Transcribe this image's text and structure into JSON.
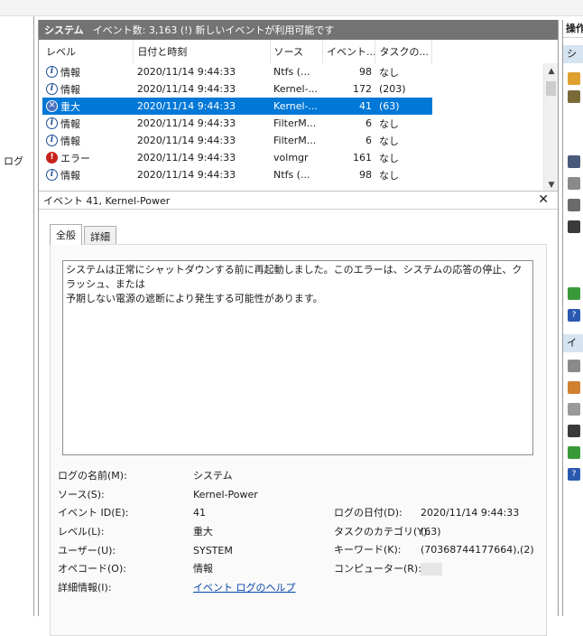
{
  "nav": {
    "log_label": "ログ"
  },
  "header": {
    "title": "システム",
    "info": "イベント数: 3,163 (!) 新しいイベントが利用可能です"
  },
  "grid": {
    "columns": [
      "レベル",
      "日付と時刻",
      "ソース",
      "イベント...",
      "タスクの..."
    ],
    "rows": [
      {
        "level": "情報",
        "icon": "information-icon",
        "datetime": "2020/11/14 9:44:33",
        "source": "Ntfs (...",
        "event_id": "98",
        "task": "なし"
      },
      {
        "level": "情報",
        "icon": "information-icon",
        "datetime": "2020/11/14 9:44:33",
        "source": "Kernel-...",
        "event_id": "172",
        "task": "(203)"
      },
      {
        "level": "重大",
        "icon": "critical-icon",
        "datetime": "2020/11/14 9:44:33",
        "source": "Kernel-...",
        "event_id": "41",
        "task": "(63)",
        "selected": true
      },
      {
        "level": "情報",
        "icon": "information-icon",
        "datetime": "2020/11/14 9:44:33",
        "source": "FilterM...",
        "event_id": "6",
        "task": "なし"
      },
      {
        "level": "情報",
        "icon": "information-icon",
        "datetime": "2020/11/14 9:44:33",
        "source": "FilterM...",
        "event_id": "6",
        "task": "なし"
      },
      {
        "level": "エラー",
        "icon": "error-icon",
        "datetime": "2020/11/14 9:44:33",
        "source": "volmgr",
        "event_id": "161",
        "task": "なし"
      },
      {
        "level": "情報",
        "icon": "information-icon",
        "datetime": "2020/11/14 9:44:33",
        "source": "Ntfs (...",
        "event_id": "98",
        "task": "なし"
      }
    ]
  },
  "detail": {
    "title": "イベント 41, Kernel-Power",
    "tabs": [
      "全般",
      "詳細"
    ],
    "description": "システムは正常にシャットダウンする前に再起動しました。このエラーは、システムの応答の停止、クラッシュ、または\n予期しない電源の遮断により発生する可能性があります。",
    "labels": {
      "log_name": "ログの名前(M):",
      "source": "ソース(S):",
      "event_id": "イベント ID(E):",
      "level": "レベル(L):",
      "user": "ユーザー(U):",
      "opcode": "オペコード(O):",
      "more_info": "詳細情報(I):",
      "logged": "ログの日付(D):",
      "task_category": "タスクのカテゴリ(Y):",
      "keywords": "キーワード(K):",
      "computer": "コンピューター(R):"
    },
    "values": {
      "log_name": "システム",
      "source": "Kernel-Power",
      "event_id": "41",
      "level": "重大",
      "user": "SYSTEM",
      "opcode": "情報",
      "more_info": "イベント ログのヘルプ",
      "logged": "2020/11/14 9:44:33",
      "task_category": "(63)",
      "keywords": "(70368744177664),(2)"
    }
  },
  "actions": {
    "title": "操作",
    "sub1": "シ",
    "sub2": "イ"
  },
  "colors": {
    "selection": "#0078d7",
    "header_bg": "#737373",
    "critical": "#4a6fbf",
    "error": "#c8211c",
    "link": "#0645ad"
  }
}
